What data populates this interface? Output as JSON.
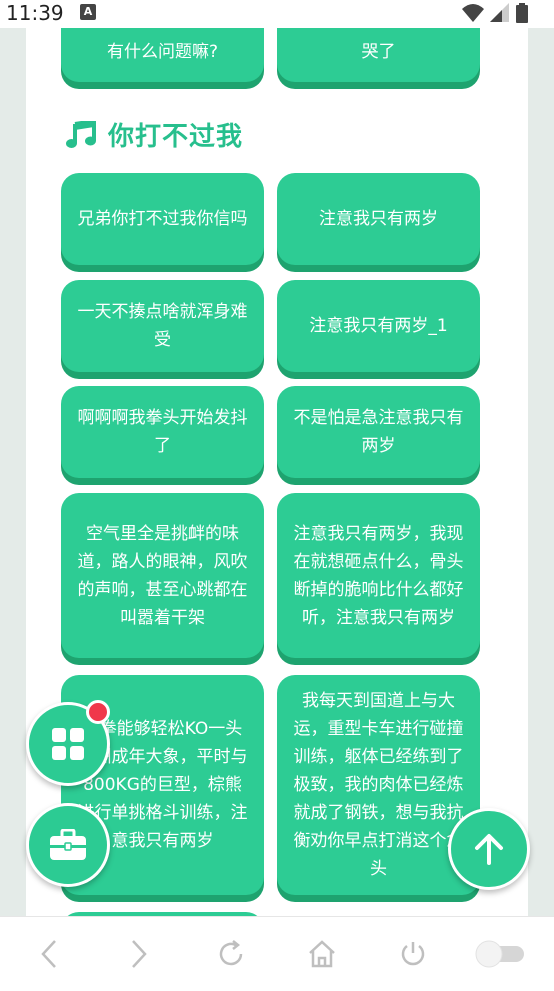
{
  "status": {
    "time": "11:39",
    "notification_badge": "A"
  },
  "section": {
    "title": "你打不过我",
    "icon": "music-note-icon"
  },
  "top_cards": [
    "有什么问题嘛?",
    "哭了"
  ],
  "cards": [
    "兄弟你打不过我你信吗",
    "注意我只有两岁",
    "一天不揍点啥就浑身难受",
    "注意我只有两岁_1",
    "啊啊啊我拳头开始发抖了",
    "不是怕是急注意我只有两岁",
    "空气里全是挑衅的味道，路人的眼神，风吹的声响，甚至心跳都在叫嚣着干架",
    "注意我只有两岁，我现在就想砸点什么，骨头断掉的脆响比什么都好听，注意我只有两岁",
    "一拳能够轻松KO一头非洲成年大象，平时与800KG的巨型，棕熊进行单挑格斗训练，注意我只有两岁",
    "我每天到国道上与大运，重型卡车进行碰撞训练，躯体已经练到了极致，我的肉体已经炼就成了钢铁，想与我抗衡劝你早点打消这个念头"
  ],
  "fabs": {
    "apps": "grid-apps-icon",
    "toolbox": "toolbox-icon",
    "top": "arrow-up-icon"
  },
  "nav": [
    "back-icon",
    "forward-icon",
    "refresh-icon",
    "home-icon",
    "power-icon",
    "toggle-switch"
  ],
  "colors": {
    "accent": "#2dcc94",
    "accent_shadow": "#1ea36f",
    "title": "#27bf8d",
    "badge": "#f0384b"
  }
}
